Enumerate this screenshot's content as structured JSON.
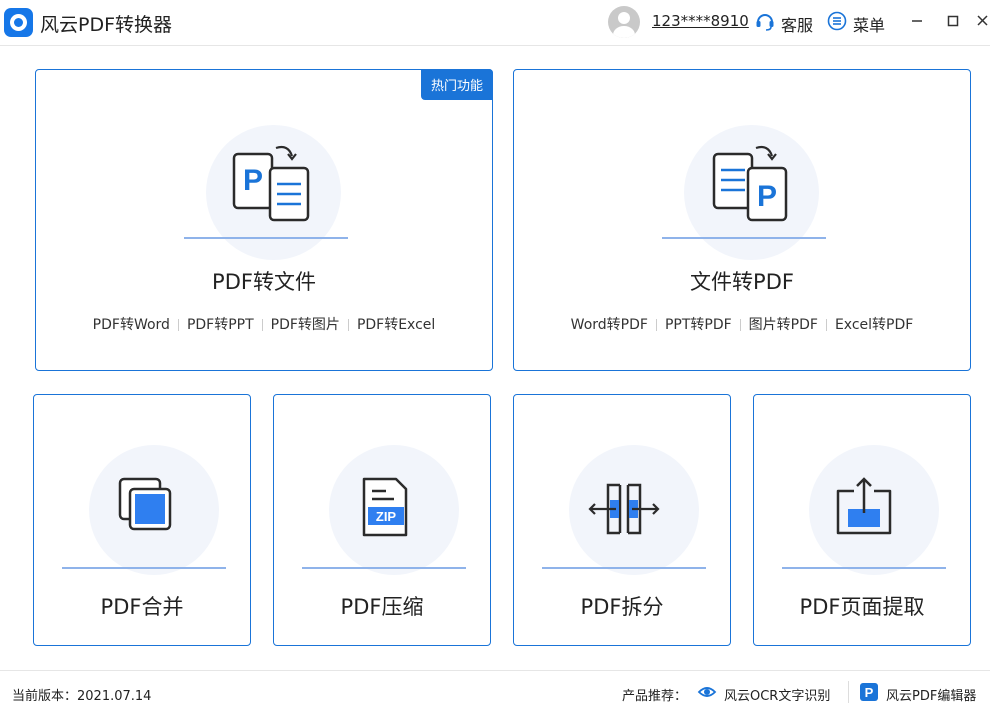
{
  "window": {
    "title": "风云PDF转换器",
    "user": "123****8910",
    "service_label": "客服",
    "menu_label": "菜单"
  },
  "colors": {
    "accent": "#1a74d8",
    "blob": "#f2f5fb",
    "line": "#8fb3ea"
  },
  "cards": {
    "pdf_to_file": {
      "badge": "热门功能",
      "title": "PDF转文件",
      "links": [
        "PDF转Word",
        "PDF转PPT",
        "PDF转图片",
        "PDF转Excel"
      ]
    },
    "file_to_pdf": {
      "title": "文件转PDF",
      "links": [
        "Word转PDF",
        "PPT转PDF",
        "图片转PDF",
        "Excel转PDF"
      ]
    },
    "merge": {
      "title": "PDF合并"
    },
    "compress": {
      "title": "PDF压缩",
      "icon_text": "ZIP"
    },
    "split": {
      "title": "PDF拆分"
    },
    "extract": {
      "title": "PDF页面提取"
    }
  },
  "footer": {
    "version": "当前版本：2021.07.14",
    "recommend_label": "产品推荐：",
    "products": [
      "风云OCR文字识别",
      "风云PDF编辑器"
    ]
  }
}
